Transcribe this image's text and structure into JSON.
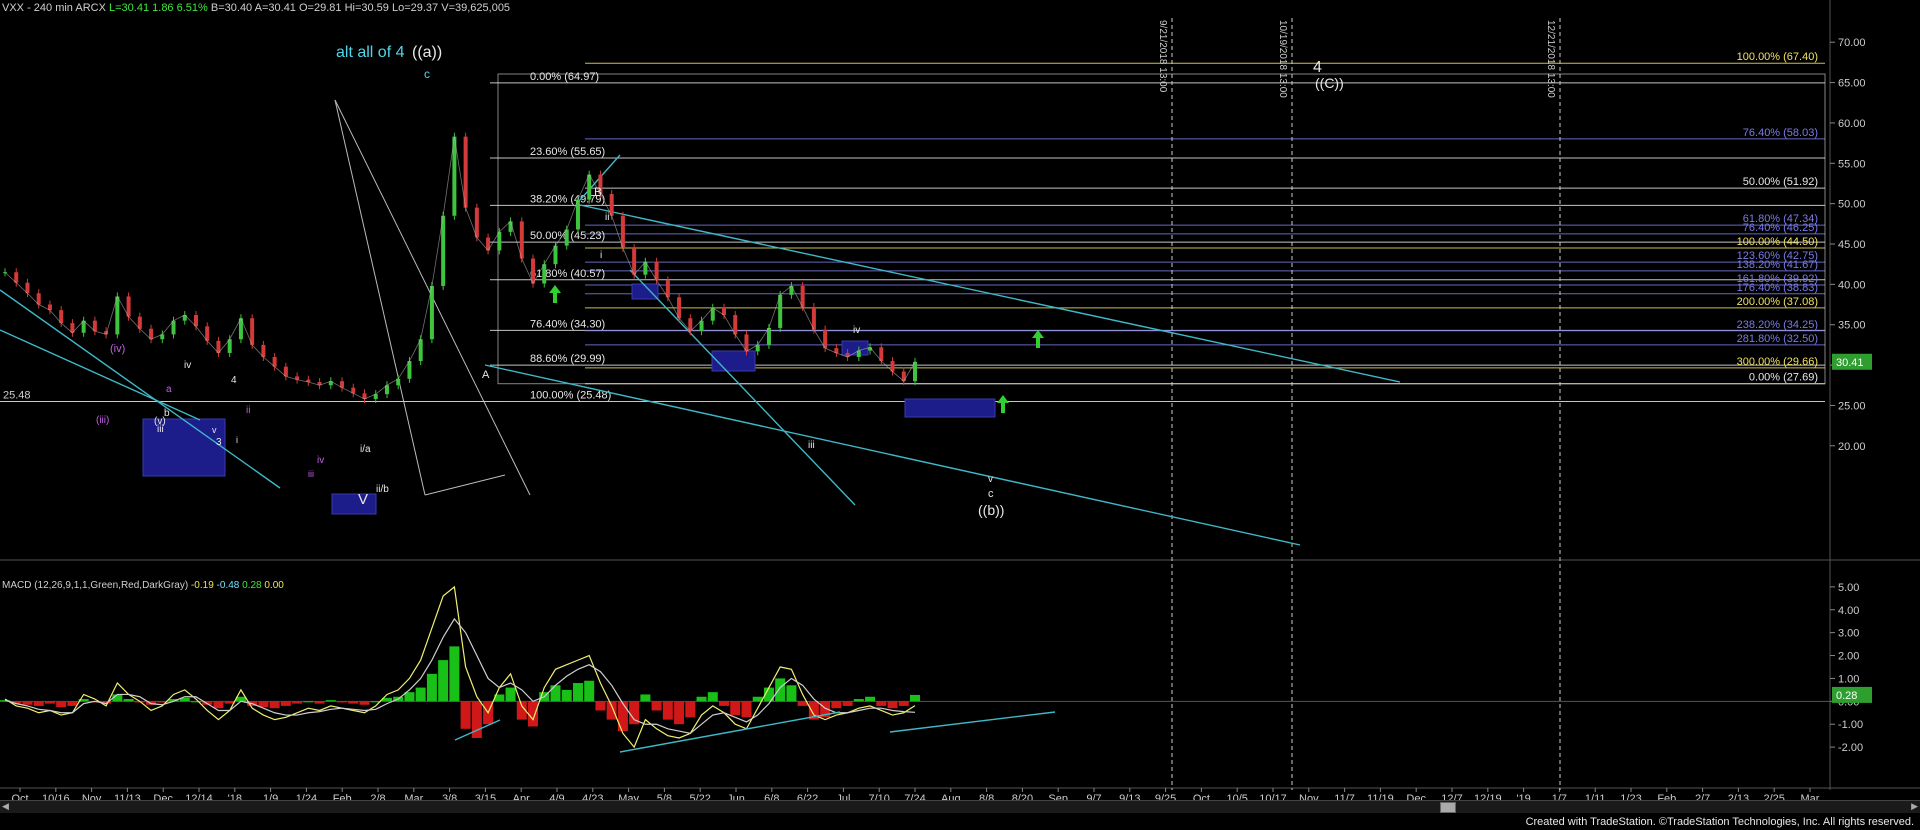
{
  "header": {
    "symbol": "VXX - 240 min ARCX",
    "last": "L=30.41",
    "change": "1.86",
    "pct": "6.51%",
    "bid": "B=30.40",
    "ask": "A=30.41",
    "open": "O=29.81",
    "high": "Hi=30.59",
    "low": "Lo=29.37",
    "volume": "V=39,625,005"
  },
  "macd_header": {
    "label": "MACD (12,26,9,1,1,Green,Red,DarkGray)",
    "v1": "-0.19",
    "v2": "-0.48",
    "v3": "0.28",
    "v4": "0.00"
  },
  "footer": {
    "credit": "Created with TradeStation. ©TradeStation Technologies, Inc. All rights reserved."
  },
  "colors": {
    "price_up": "#3ec43e",
    "price_down": "#d43a3a",
    "fib_white": "#e8e8e8",
    "fib_yellow": "#f0e060",
    "fib_blue": "#7a7ae8",
    "trend_cyan": "#3fb8c8",
    "wave_cyan": "#4fd6ea",
    "box_blue": "#1c1c8a",
    "last_price_green": "#2e9e2e"
  },
  "chart_data": [
    {
      "type": "line",
      "title": "VXX - 240 min ARCX",
      "ylim": [
        17,
        73
      ],
      "y_ticks": [
        "70.00",
        "65.00",
        "60.00",
        "55.00",
        "50.00",
        "45.00",
        "40.00",
        "35.00",
        "30.00",
        "25.00",
        "20.00"
      ],
      "x_ticks": [
        "Oct",
        "10/16",
        "Nov",
        "11/13",
        "Dec",
        "12/14",
        "'18",
        "1/9",
        "1/24",
        "Feb",
        "2/8",
        "Mar",
        "3/8",
        "3/15",
        "Apr",
        "4/9",
        "4/23",
        "May",
        "5/8",
        "5/22",
        "Jun",
        "6/8",
        "6/22",
        "Jul",
        "7/10",
        "7/24",
        "Aug",
        "8/8",
        "8/20",
        "Sep",
        "9/7",
        "9/13",
        "9/25",
        "Oct",
        "10/5",
        "10/17",
        "Nov",
        "11/7",
        "11/19",
        "Dec",
        "12/7",
        "12/19",
        "'19",
        "1/7",
        "1/11",
        "1/23",
        "Feb",
        "2/7",
        "2/13",
        "2/25",
        "Mar"
      ],
      "series": [
        {
          "x": [
            0,
            10,
            20,
            30,
            40,
            50,
            60,
            70,
            80,
            90,
            100,
            110,
            120,
            130,
            140,
            150,
            160,
            170,
            180,
            190,
            200,
            210,
            220,
            230,
            240,
            250,
            260,
            270,
            280,
            290,
            300,
            310,
            320,
            330,
            340,
            350,
            360,
            370,
            380,
            390,
            400,
            410,
            420,
            430,
            440,
            450,
            460,
            470,
            480,
            490,
            500,
            510,
            520,
            530,
            540,
            550,
            560,
            570,
            580,
            590,
            600,
            610,
            620,
            630,
            640,
            650,
            660,
            670,
            680,
            690,
            700,
            710,
            720,
            730,
            740,
            750,
            760,
            770,
            780,
            790,
            800,
            810
          ],
          "values": [
            41.5,
            40.2,
            38.9,
            37.5,
            36.8,
            35.2,
            34.0,
            35.5,
            34.2,
            33.8,
            38.5,
            36.0,
            34.5,
            33.2,
            33.8,
            35.5,
            36.2,
            34.8,
            33.0,
            31.5,
            33.2,
            35.8,
            32.5,
            31.0,
            29.8,
            28.6,
            28.2,
            27.9,
            27.5,
            28.0,
            27.2,
            26.5,
            25.8,
            26.4,
            27.5,
            28.3,
            30.5,
            33.2,
            39.8,
            48.5,
            58.3,
            49.5,
            45.8,
            44.2,
            46.5,
            47.8,
            43.2,
            40.1,
            42.5,
            44.8,
            46.8,
            50.5,
            53.6,
            51.2,
            48.5,
            44.5,
            41.2,
            42.8,
            40.5,
            38.4,
            35.8,
            34.2,
            35.5,
            37.1,
            36.2,
            33.8,
            31.7,
            32.5,
            34.6,
            38.7,
            39.8,
            37.2,
            34.4,
            32.1,
            31.5,
            31.0,
            31.8,
            32.2,
            30.5,
            29.2,
            28.0,
            30.4
          ]
        }
      ],
      "levels": [
        {
          "label": "100.00% (67.40)",
          "value": 67.4,
          "color": "#f0e060",
          "side": "right"
        },
        {
          "label": "0.00% (64.97)",
          "value": 64.97,
          "color": "#e8e8e8",
          "side": "left"
        },
        {
          "label": "76.40% (58.03)",
          "value": 58.03,
          "color": "#7a7ae8",
          "side": "right"
        },
        {
          "label": "23.60% (55.65)",
          "value": 55.65,
          "color": "#e8e8e8",
          "side": "left"
        },
        {
          "label": "50.00% (51.92)",
          "value": 51.92,
          "color": "#e8e8e8",
          "side": "right"
        },
        {
          "label": "38.20% (49.79)",
          "value": 49.79,
          "color": "#e8e8e8",
          "side": "left"
        },
        {
          "label": "61.80% (47.34)",
          "value": 47.34,
          "color": "#7a7ae8",
          "side": "right"
        },
        {
          "label": "76.40% (46.25)",
          "value": 46.25,
          "color": "#7a7ae8",
          "side": "right"
        },
        {
          "label": "50.00% (45.23)",
          "value": 45.23,
          "color": "#e8e8e8",
          "side": "left"
        },
        {
          "label": "100.00% (44.50)",
          "value": 44.5,
          "color": "#f0e060",
          "side": "right"
        },
        {
          "label": "123.60% (42.75)",
          "value": 42.75,
          "color": "#7a7ae8",
          "side": "right"
        },
        {
          "label": "138.20% (41.67)",
          "value": 41.67,
          "color": "#7a7ae8",
          "side": "right"
        },
        {
          "label": "61.80% (40.57)",
          "value": 40.57,
          "color": "#e8e8e8",
          "side": "left"
        },
        {
          "label": "161.80% (39.92)",
          "value": 39.92,
          "color": "#7a7ae8",
          "side": "right"
        },
        {
          "label": "176.40% (38.83)",
          "value": 38.83,
          "color": "#7a7ae8",
          "side": "right"
        },
        {
          "label": "200.00% (37.08)",
          "value": 37.08,
          "color": "#f0e060",
          "side": "right"
        },
        {
          "label": "76.40% (34.30)",
          "value": 34.3,
          "color": "#e8e8e8",
          "side": "left"
        },
        {
          "label": "238.20% (34.25)",
          "value": 34.25,
          "color": "#7a7ae8",
          "side": "right"
        },
        {
          "label": "281.80% (32.50)",
          "value": 32.5,
          "color": "#7a7ae8",
          "side": "right"
        },
        {
          "label": "88.60% (29.99)",
          "value": 29.99,
          "color": "#e8e8e8",
          "side": "left"
        },
        {
          "label": "300.00% (29.66)",
          "value": 29.66,
          "color": "#f0e060",
          "side": "right"
        },
        {
          "label": "0.00% (27.69)",
          "value": 27.69,
          "color": "#e8e8e8",
          "side": "right"
        },
        {
          "label": "100.00% (25.48)",
          "value": 25.48,
          "color": "#e8e8e8",
          "side": "left"
        }
      ],
      "last_price": "30.41",
      "left_level": "25.48",
      "vertical_markers": [
        "9/21/2018 13:00",
        "10/19/2018 13:00",
        "12/21/2018 13:00"
      ],
      "annotations": [
        {
          "text": "alt all of 4",
          "color": "#4fd6ea"
        },
        {
          "text": "((a))",
          "color": "#e8e8e8"
        },
        {
          "text": "c",
          "color": "#4fd6ea"
        },
        {
          "text": "4",
          "color": "#e8e8e8"
        },
        {
          "text": "((C))",
          "color": "#e8e8e8"
        },
        {
          "text": "B",
          "color": "#e8e8e8"
        },
        {
          "text": "ii",
          "color": "#e8e8e8"
        },
        {
          "text": "i",
          "color": "#e8e8e8"
        },
        {
          "text": "iv",
          "color": "#e8e8e8"
        },
        {
          "text": "iii",
          "color": "#e8e8e8"
        },
        {
          "text": "v",
          "color": "#e8e8e8"
        },
        {
          "text": "c",
          "color": "#e8e8e8"
        },
        {
          "text": "((b))",
          "color": "#e8e8e8"
        },
        {
          "text": "A",
          "color": "#e8e8e8"
        },
        {
          "text": "V",
          "color": "#e8e8e8"
        },
        {
          "text": "i/a",
          "color": "#e8e8e8"
        },
        {
          "text": "ii/b",
          "color": "#e8e8e8"
        },
        {
          "text": "(iv)",
          "color": "#c060e0"
        },
        {
          "text": "(iii)",
          "color": "#c060e0"
        },
        {
          "text": "iv",
          "color": "#e8e8e8"
        },
        {
          "text": "a",
          "color": "#c060e0"
        },
        {
          "text": "(v)",
          "color": "#e8e8e8"
        },
        {
          "text": "iii",
          "color": "#e8e8e8"
        },
        {
          "text": "b",
          "color": "#e8e8e8"
        },
        {
          "text": "4",
          "color": "#e8e8e8"
        },
        {
          "text": "3",
          "color": "#e8e8e8"
        },
        {
          "text": "v",
          "color": "#e8e8e8"
        },
        {
          "text": "i",
          "color": "#e8e8e8"
        },
        {
          "text": "ii",
          "color": "#c060e0"
        },
        {
          "text": "iv",
          "color": "#c060e0"
        },
        {
          "text": "iii",
          "color": "#c060e0"
        }
      ]
    },
    {
      "type": "bar",
      "title": "MACD (12,26,9,1,1,Green,Red,DarkGray)",
      "ylim": [
        -3,
        5.3
      ],
      "y_ticks": [
        "5.00",
        "4.00",
        "3.00",
        "2.00",
        "1.00",
        "0.00",
        "-1.00",
        "-2.00"
      ],
      "last_value": "0.28",
      "x": [
        0,
        10,
        20,
        30,
        40,
        50,
        60,
        70,
        80,
        90,
        100,
        110,
        120,
        130,
        140,
        150,
        160,
        170,
        180,
        190,
        200,
        210,
        220,
        230,
        240,
        250,
        260,
        270,
        280,
        290,
        300,
        310,
        320,
        330,
        340,
        350,
        360,
        370,
        380,
        390,
        400,
        410,
        420,
        430,
        440,
        450,
        460,
        470,
        480,
        490,
        500,
        510,
        520,
        530,
        540,
        550,
        560,
        570,
        580,
        590,
        600,
        610,
        620,
        630,
        640,
        650,
        660,
        670,
        680,
        690,
        700,
        710,
        720,
        730,
        740,
        750,
        760,
        770,
        780,
        790,
        800,
        810
      ],
      "histogram": [
        0.05,
        -0.1,
        -0.15,
        -0.2,
        -0.1,
        -0.25,
        -0.2,
        0.1,
        -0.05,
        -0.1,
        0.3,
        0.1,
        -0.05,
        -0.15,
        -0.05,
        0.1,
        0.15,
        0.0,
        -0.15,
        -0.3,
        -0.1,
        0.2,
        -0.2,
        -0.25,
        -0.3,
        -0.2,
        -0.1,
        0.0,
        -0.1,
        0.05,
        -0.05,
        -0.1,
        -0.15,
        0.0,
        0.15,
        0.2,
        0.4,
        0.6,
        1.2,
        1.8,
        2.4,
        -1.2,
        -1.6,
        -1.0,
        0.3,
        0.6,
        -0.8,
        -1.1,
        0.4,
        0.7,
        0.5,
        0.8,
        0.9,
        -0.4,
        -0.8,
        -1.3,
        -1.0,
        0.3,
        -0.4,
        -0.8,
        -1.0,
        -0.7,
        0.2,
        0.4,
        -0.2,
        -0.6,
        -0.7,
        0.2,
        0.6,
        1.0,
        0.7,
        -0.2,
        -0.8,
        -0.7,
        -0.3,
        -0.2,
        0.1,
        0.2,
        -0.2,
        -0.3,
        -0.2,
        0.28
      ],
      "macd": [
        0.1,
        -0.2,
        -0.3,
        -0.5,
        -0.4,
        -0.6,
        -0.5,
        0.3,
        0.1,
        -0.2,
        0.8,
        0.3,
        0.0,
        -0.4,
        -0.2,
        0.3,
        0.5,
        0.1,
        -0.4,
        -0.8,
        -0.4,
        0.5,
        -0.3,
        -0.6,
        -0.8,
        -0.7,
        -0.5,
        -0.3,
        -0.4,
        -0.2,
        -0.3,
        -0.4,
        -0.5,
        -0.2,
        0.3,
        0.5,
        1.0,
        1.8,
        3.2,
        4.6,
        5.0,
        1.5,
        0.2,
        -0.5,
        0.6,
        1.2,
        -0.2,
        -0.8,
        0.6,
        1.4,
        1.6,
        1.8,
        2.0,
        0.8,
        -0.2,
        -1.4,
        -2.0,
        -0.8,
        -1.2,
        -1.5,
        -1.6,
        -1.4,
        -0.6,
        -0.2,
        -0.5,
        -1.0,
        -1.2,
        -0.3,
        0.6,
        1.5,
        1.4,
        0.3,
        -0.6,
        -0.8,
        -0.6,
        -0.5,
        -0.3,
        -0.2,
        -0.4,
        -0.6,
        -0.5,
        -0.19
      ],
      "signal": [
        0.05,
        -0.1,
        -0.2,
        -0.35,
        -0.4,
        -0.5,
        -0.5,
        -0.1,
        0.0,
        -0.1,
        0.3,
        0.3,
        0.2,
        -0.1,
        -0.15,
        0.0,
        0.2,
        0.2,
        -0.1,
        -0.4,
        -0.4,
        0.0,
        -0.1,
        -0.3,
        -0.5,
        -0.6,
        -0.6,
        -0.5,
        -0.45,
        -0.35,
        -0.3,
        -0.35,
        -0.4,
        -0.35,
        -0.1,
        0.1,
        0.5,
        1.0,
        1.8,
        2.8,
        3.6,
        3.0,
        2.0,
        1.0,
        0.6,
        0.8,
        0.5,
        0.0,
        0.2,
        0.7,
        1.1,
        1.4,
        1.6,
        1.3,
        0.7,
        -0.1,
        -0.8,
        -1.0,
        -1.0,
        -1.2,
        -1.3,
        -1.4,
        -1.0,
        -0.6,
        -0.5,
        -0.7,
        -0.9,
        -0.6,
        -0.1,
        0.6,
        1.0,
        0.7,
        0.1,
        -0.3,
        -0.5,
        -0.5,
        -0.4,
        -0.3,
        -0.3,
        -0.4,
        -0.45,
        -0.48
      ]
    }
  ]
}
